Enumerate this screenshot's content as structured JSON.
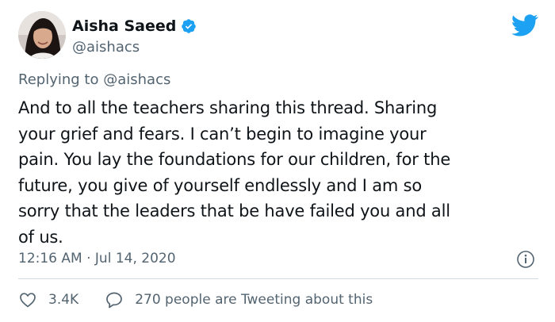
{
  "tweet": {
    "author": {
      "display_name": "Aisha Saeed",
      "handle": "@aishacs",
      "verified": true,
      "avatar": "avatar-photo"
    },
    "brand_icon": "twitter-bird-icon",
    "replying_to": {
      "prefix": "Replying to",
      "mention": "@aishacs"
    },
    "text_lines": [
      "And to all the teachers sharing this thread. Sharing",
      "your grief and fears. I can’t begin to imagine your",
      "pain. You lay the foundations for our children, for the",
      "future, you give of yourself endlessly and I am so",
      "sorry that the leaders that be have failed you and all",
      "of us."
    ],
    "timestamp": "12:16 AM · Jul 14, 2020",
    "info_icon": "info-icon",
    "actions": {
      "likes": "3.4K",
      "replies_text": "270 people are Tweeting about this"
    },
    "colors": {
      "brand": "#1da1f2",
      "secondary_text": "#536471",
      "primary_text": "#0f1419",
      "divider": "#cfd9de"
    }
  }
}
